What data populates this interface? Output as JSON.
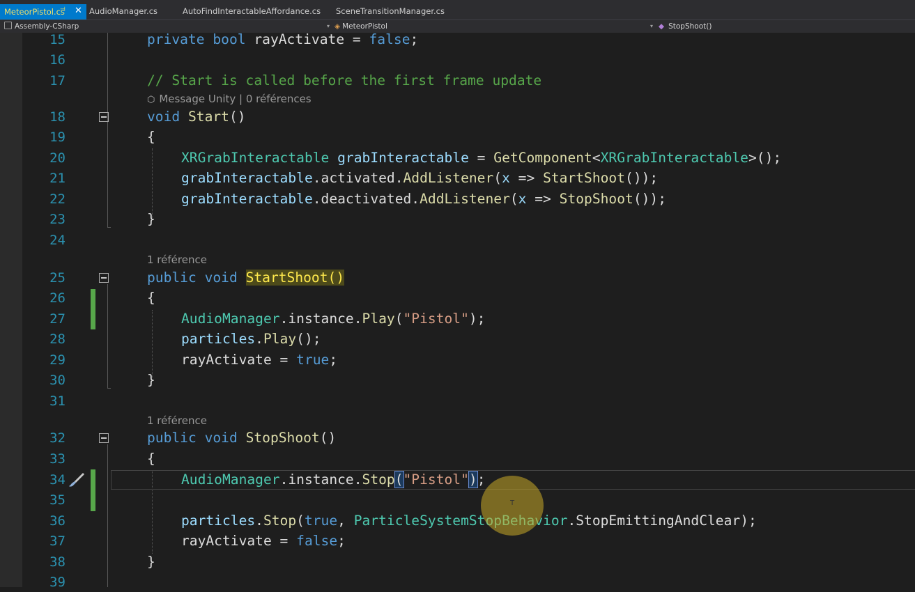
{
  "tabs": [
    {
      "label": "MeteorPistol.cs",
      "active": true
    },
    {
      "label": "AudioManager.cs"
    },
    {
      "label": "AutoFindInteractableAffordance.cs"
    },
    {
      "label": "SceneTransitionManager.cs"
    }
  ],
  "nav": {
    "project": "Assembly-CSharp",
    "class": "MeteorPistol",
    "member": "StopShoot()"
  },
  "code_lens": {
    "message_unity": "Message Unity | 0 références",
    "one_reference": "1 référence"
  },
  "lines": [
    {
      "n": "15",
      "text": "private bool rayActivate = false;"
    },
    {
      "n": "16",
      "text": ""
    },
    {
      "n": "17",
      "text": "// Start is called before the first frame update"
    },
    {
      "n": "18",
      "text": "void Start()"
    },
    {
      "n": "19",
      "text": "{"
    },
    {
      "n": "20",
      "text": "XRGrabInteractable grabInteractable = GetComponent<XRGrabInteractable>();"
    },
    {
      "n": "21",
      "text": "grabInteractable.activated.AddListener(x => StartShoot());"
    },
    {
      "n": "22",
      "text": "grabInteractable.deactivated.AddListener(x => StopShoot());"
    },
    {
      "n": "23",
      "text": "}"
    },
    {
      "n": "24",
      "text": ""
    },
    {
      "n": "25",
      "text": "public void StartShoot()"
    },
    {
      "n": "26",
      "text": "{"
    },
    {
      "n": "27",
      "text": "AudioManager.instance.Play(\"Pistol\");"
    },
    {
      "n": "28",
      "text": "particles.Play();"
    },
    {
      "n": "29",
      "text": "rayActivate = true;"
    },
    {
      "n": "30",
      "text": "}"
    },
    {
      "n": "31",
      "text": ""
    },
    {
      "n": "32",
      "text": "public void StopShoot()"
    },
    {
      "n": "33",
      "text": "{"
    },
    {
      "n": "34",
      "text": "AudioManager.instance.Stop(\"Pistol\");"
    },
    {
      "n": "35",
      "text": ""
    },
    {
      "n": "36",
      "text": "particles.Stop(true, ParticleSystemStopBehavior.StopEmittingAndClear);"
    },
    {
      "n": "37",
      "text": "rayActivate = false;"
    },
    {
      "n": "38",
      "text": "}"
    },
    {
      "n": "39",
      "text": ""
    }
  ],
  "tokens": {
    "l15": [
      "private",
      "bool",
      "rayActivate = ",
      "false",
      ";"
    ],
    "l17": "// Start is called before the first frame update",
    "l18": [
      "void",
      "Start",
      "()"
    ],
    "l20": [
      "XRGrabInteractable",
      "grabInteractable",
      " = ",
      "GetComponent",
      "<",
      "XRGrabInteractable",
      ">();"
    ],
    "l21": [
      "grabInteractable",
      ".activated.",
      "AddListener",
      "(",
      "x",
      " => ",
      "StartShoot",
      "());"
    ],
    "l22": [
      "grabInteractable",
      ".deactivated.",
      "AddListener",
      "(",
      "x",
      " => ",
      "StopShoot",
      "());"
    ],
    "l25": [
      "public",
      "void",
      "StartShoot()"
    ],
    "l27": [
      "AudioManager",
      ".instance.",
      "Play",
      "(",
      "\"Pistol\"",
      ");"
    ],
    "l28": [
      "particles",
      ".",
      "Play",
      "();"
    ],
    "l29": [
      "rayActivate = ",
      "true",
      ";"
    ],
    "l32": [
      "public",
      "void",
      "StopShoot",
      "()"
    ],
    "l34": [
      "AudioManager",
      ".instance.",
      "Stop",
      "(",
      "\"Pistol\"",
      ")",
      ";"
    ],
    "l36": [
      "particles",
      ".",
      "Stop",
      "(",
      "true",
      ", ",
      "ParticleSystemStopBehavior",
      ".",
      "StopEmittingAndClear",
      ");"
    ],
    "l37": [
      "rayActivate = ",
      "false",
      ";"
    ],
    "brace_open": "{",
    "brace_close": "}"
  },
  "cursor_label": "T",
  "colors": {
    "keyword": "#569cd6",
    "type": "#4ec9b0",
    "method": "#dcdcaa",
    "string": "#d69d85",
    "comment": "#57a64a",
    "line_number": "#2b91af",
    "active_tab": "#007acc"
  }
}
